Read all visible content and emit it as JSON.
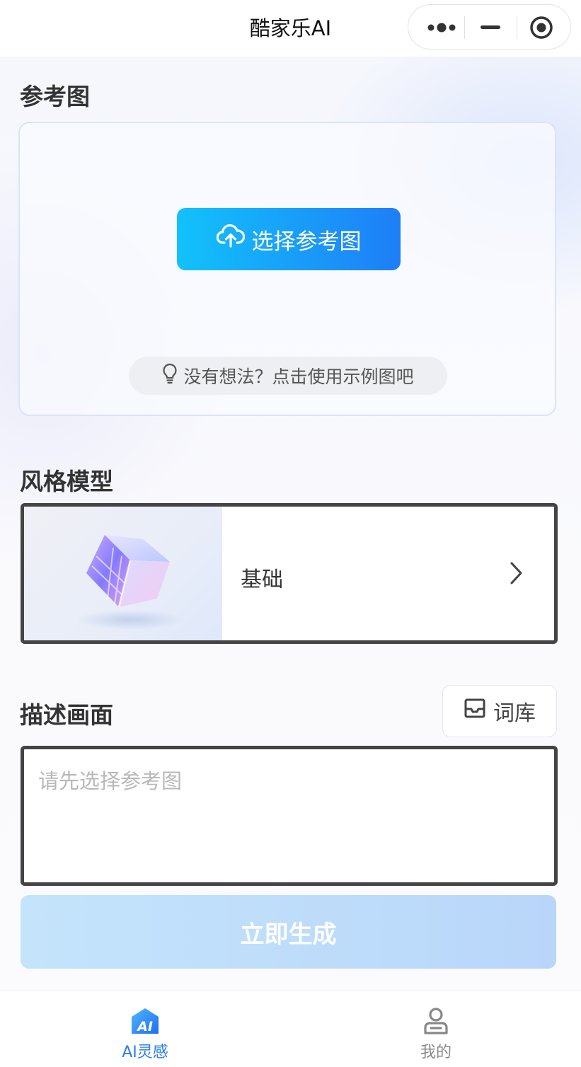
{
  "nav": {
    "title": "酷家乐AI"
  },
  "reference": {
    "section_title": "参考图",
    "choose_label": "选择参考图",
    "tip_label": "没有想法？点击使用示例图吧"
  },
  "style_model": {
    "section_title": "风格模型",
    "selected_name": "基础"
  },
  "description": {
    "section_title": "描述画面",
    "lexicon_label": "词库",
    "placeholder": "请先选择参考图",
    "value": ""
  },
  "generate": {
    "label": "立即生成"
  },
  "tabbar": {
    "tabs": [
      {
        "label": "AI灵感",
        "icon": "ai-icon",
        "active": true
      },
      {
        "label": "我的",
        "icon": "person-icon",
        "active": false
      }
    ]
  },
  "colors": {
    "accent": "#2a7df0",
    "button_gradient_start": "#12c2fb",
    "button_gradient_end": "#1e7ef7",
    "disabled_button": "#c4e4fb"
  }
}
